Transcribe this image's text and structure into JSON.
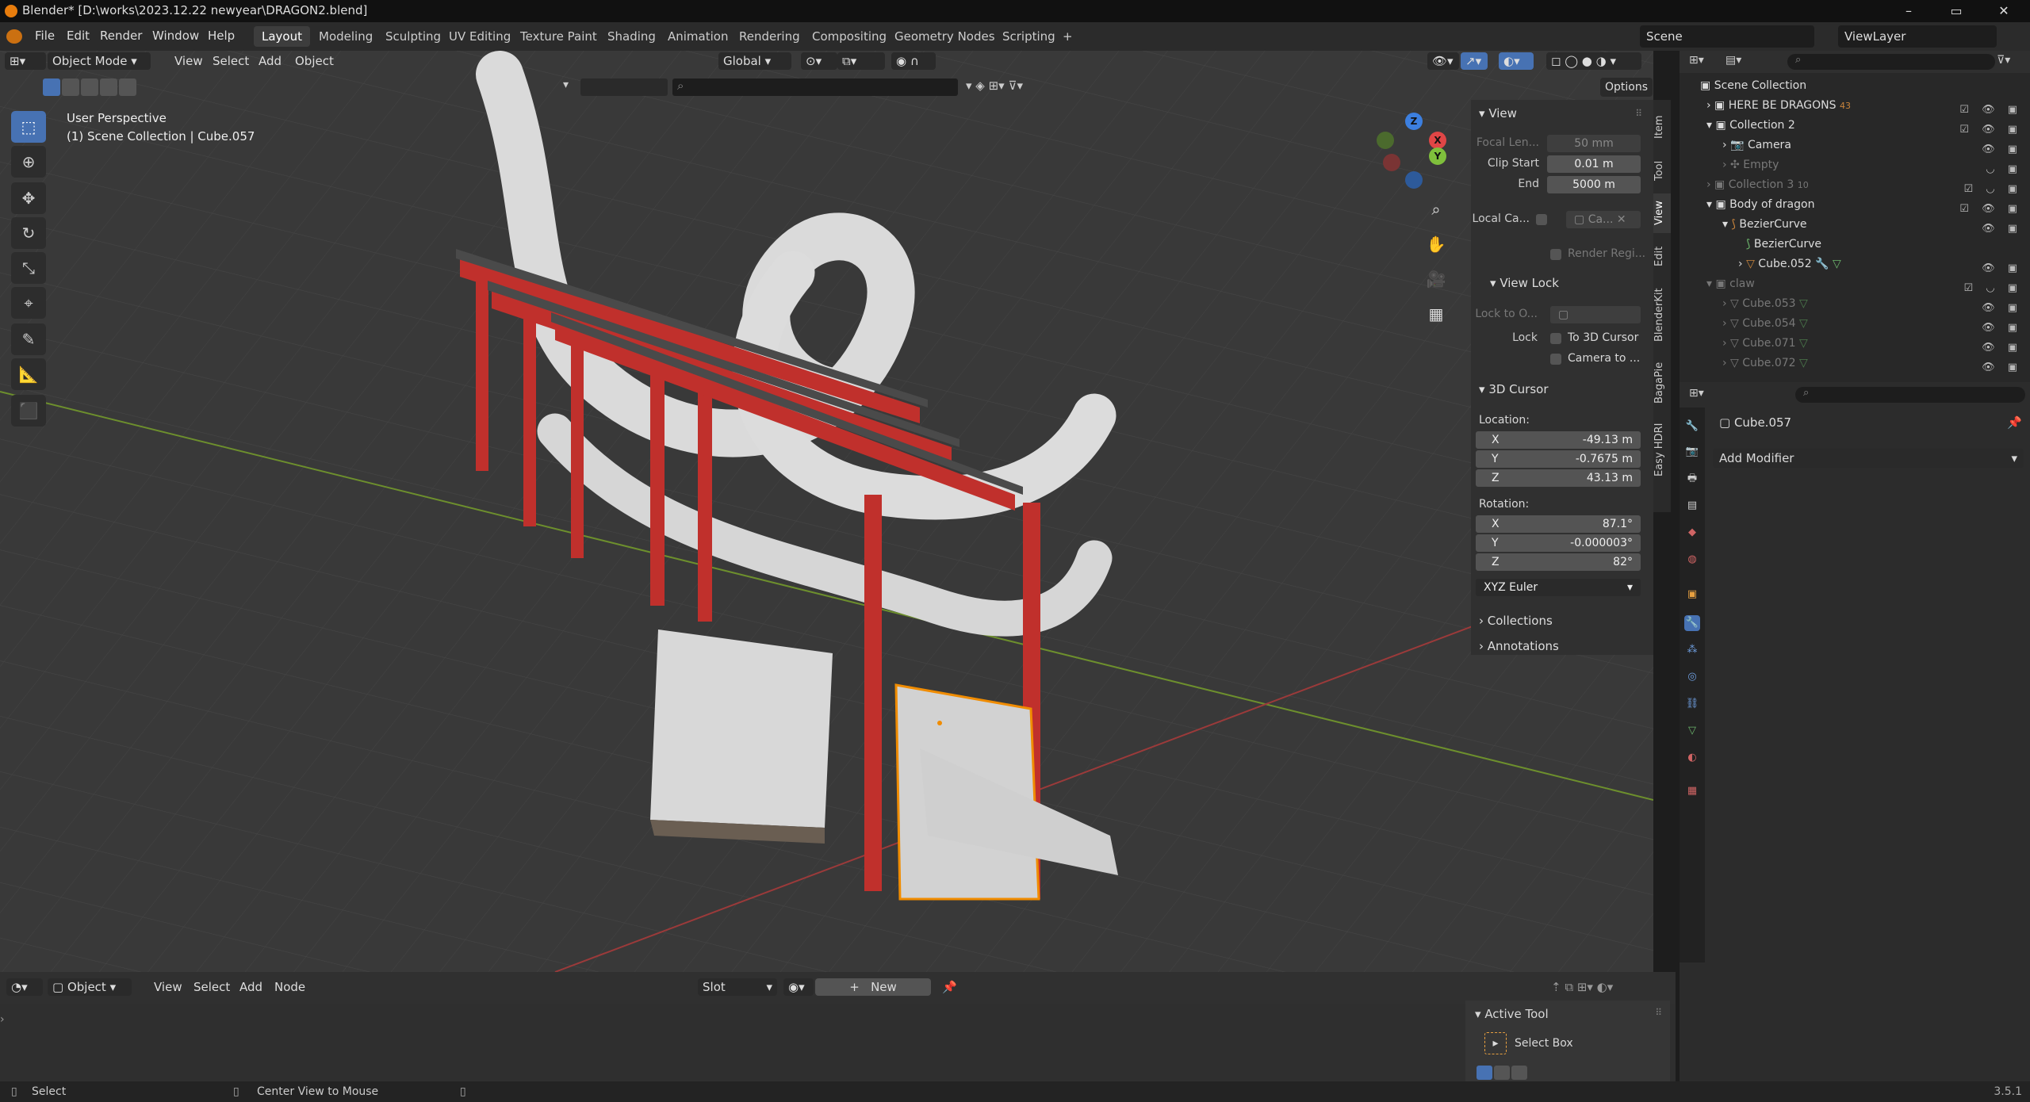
{
  "window": {
    "title": "Blender* [D:\\works\\2023.12.22 newyear\\DRAGON2.blend]",
    "min": "–",
    "max": "▭",
    "close": "✕"
  },
  "menubar": {
    "menus": [
      "File",
      "Edit",
      "Render",
      "Window",
      "Help"
    ],
    "workspaces": [
      "Layout",
      "Modeling",
      "Sculpting",
      "UV Editing",
      "Texture Paint",
      "Shading",
      "Animation",
      "Rendering",
      "Compositing",
      "Geometry Nodes",
      "Scripting"
    ],
    "active_workspace": "Layout",
    "add_workspace": "+",
    "scene": "Scene",
    "view_layer": "ViewLayer"
  },
  "viewport": {
    "mode": "Object Mode",
    "menus": [
      "View",
      "Select",
      "Add",
      "Object"
    ],
    "orientation": "Global",
    "options": "Options",
    "info_line1": "User Perspective",
    "info_line2": "(1) Scene Collection | Cube.057"
  },
  "npanel": {
    "tabs": [
      "Item",
      "Tool",
      "View",
      "Edit",
      "BlenderKit",
      "BagaPie",
      "Easy HDRI"
    ],
    "view_header": "View",
    "focal_label": "Focal Len...",
    "focal_value": "50 mm",
    "clip_start_label": "Clip Start",
    "clip_start_value": "0.01 m",
    "clip_end_label": "End",
    "clip_end_value": "5000 m",
    "local_camera_label": "Local Ca...",
    "local_camera_value": "Ca...",
    "render_region": "Render Regi...",
    "view_lock_header": "View Lock",
    "lock_to_label": "Lock to O...",
    "lock_label": "Lock",
    "to_3d_cursor": "To 3D Cursor",
    "camera_to": "Camera to ...",
    "cursor_header": "3D Cursor",
    "location_label": "Location:",
    "loc_x": "-49.13 m",
    "loc_y": "-0.7675 m",
    "loc_z": "43.13 m",
    "rotation_label": "Rotation:",
    "rot_x": "87.1°",
    "rot_y": "-0.000003°",
    "rot_z": "82°",
    "rotation_mode": "XYZ Euler",
    "x": "X",
    "y": "Y",
    "z": "Z",
    "collections": "Collections",
    "annotations": "Annotations"
  },
  "outliner": {
    "root": "Scene Collection",
    "rows": [
      {
        "name": "HERE BE DRAGONS",
        "badge": "43"
      },
      {
        "name": "Collection 2",
        "badge": ""
      },
      {
        "name": "Camera",
        "badge": ""
      },
      {
        "name": "Empty",
        "badge": ""
      },
      {
        "name": "Collection 3",
        "badge": "10"
      },
      {
        "name": "Body of dragon",
        "badge": ""
      },
      {
        "name": "BezierCurve",
        "badge": ""
      },
      {
        "name": "BezierCurve",
        "badge": ""
      },
      {
        "name": "Cube.052",
        "badge": ""
      },
      {
        "name": "claw",
        "badge": ""
      },
      {
        "name": "Cube.053",
        "badge": ""
      },
      {
        "name": "Cube.054",
        "badge": ""
      },
      {
        "name": "Cube.071",
        "badge": ""
      },
      {
        "name": "Cube.072",
        "badge": ""
      }
    ]
  },
  "properties": {
    "object_name": "Cube.057",
    "add_modifier": "Add Modifier"
  },
  "shader": {
    "object": "Object",
    "menus": [
      "View",
      "Select",
      "Add",
      "Node"
    ],
    "slot": "Slot",
    "new": "New",
    "active_tool_header": "Active Tool",
    "select_box": "Select Box"
  },
  "statusbar": {
    "select": "Select",
    "center_view": "Center View to Mouse",
    "version": "3.5.1"
  },
  "colors": {
    "accent": "#4772b3",
    "selected_outline": "#f08c00",
    "torii_red": "#c0302c",
    "axis_x": "#e04646",
    "axis_y": "#7fbf3c",
    "axis_z": "#3c7fdf"
  }
}
